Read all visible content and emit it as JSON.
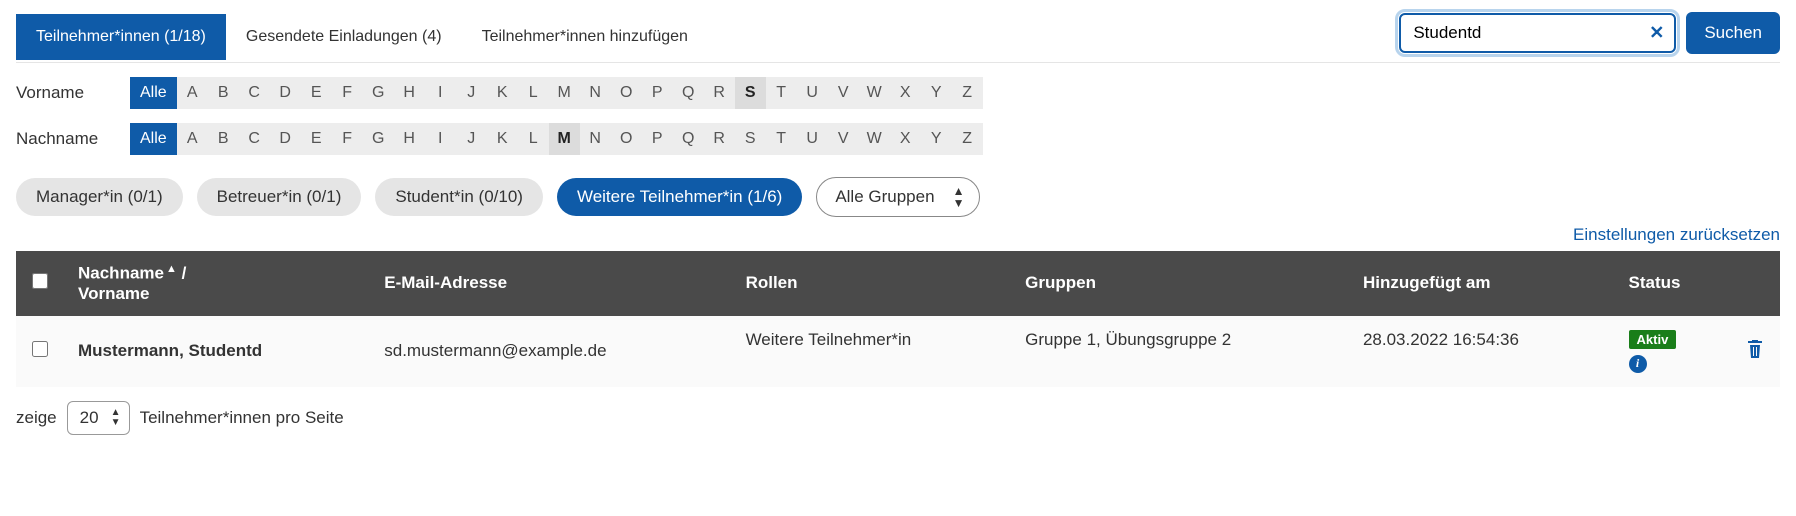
{
  "tabs": [
    {
      "label": "Teilnehmer*innen (1/18)",
      "active": true
    },
    {
      "label": "Gesendete Einladungen (4)",
      "active": false
    },
    {
      "label": "Teilnehmer*innen hinzufügen",
      "active": false
    }
  ],
  "search": {
    "value": "Studentd",
    "button_label": "Suchen"
  },
  "alpha_filters": {
    "all_label": "Alle",
    "letters": [
      "A",
      "B",
      "C",
      "D",
      "E",
      "F",
      "G",
      "H",
      "I",
      "J",
      "K",
      "L",
      "M",
      "N",
      "O",
      "P",
      "Q",
      "R",
      "S",
      "T",
      "U",
      "V",
      "W",
      "X",
      "Y",
      "Z"
    ],
    "vorname": {
      "label": "Vorname",
      "all_active": true,
      "selected": "S"
    },
    "nachname": {
      "label": "Nachname",
      "all_active": true,
      "selected": "M"
    }
  },
  "role_chips": [
    {
      "label": "Manager*in (0/1)",
      "active": false
    },
    {
      "label": "Betreuer*in (0/1)",
      "active": false
    },
    {
      "label": "Student*in (0/10)",
      "active": false
    },
    {
      "label": "Weitere Teilnehmer*in (1/6)",
      "active": true
    }
  ],
  "group_select": {
    "label": "Alle Gruppen"
  },
  "reset_link": "Einstellungen zurücksetzen",
  "table": {
    "headers": {
      "name": "Nachname",
      "name_sep": " / ",
      "firstname": "Vorname",
      "email": "E-Mail-Adresse",
      "roles": "Rollen",
      "groups": "Gruppen",
      "added": "Hinzugefügt am",
      "status": "Status"
    },
    "rows": [
      {
        "name": "Mustermann, Studentd",
        "email": "sd.mustermann@example.de",
        "roles": "Weitere Teilnehmer*in",
        "groups": "Gruppe 1, Übungsgruppe 2",
        "added": "28.03.2022 16:54:36",
        "status": "Aktiv"
      }
    ]
  },
  "pager": {
    "prefix": "zeige",
    "value": "20",
    "suffix": "Teilnehmer*innen pro Seite"
  }
}
